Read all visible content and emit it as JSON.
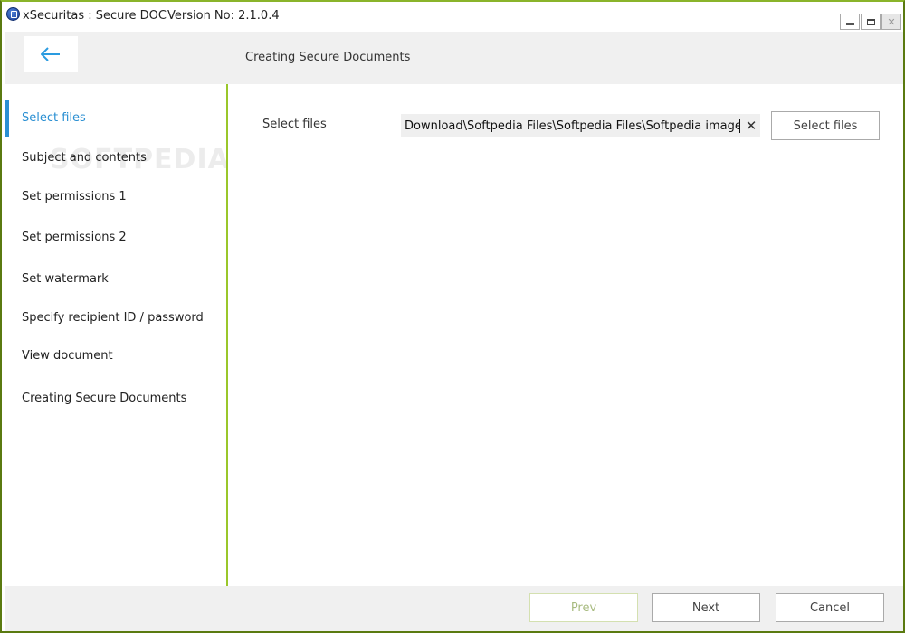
{
  "window": {
    "title": "xSecuritas : Secure DOC",
    "version": "Version No: 2.1.0.4",
    "controls": {
      "minimize_icon": "minimize-icon",
      "maximize_icon": "maximize-icon",
      "close_icon": "close-icon",
      "close_glyph": "✕"
    }
  },
  "header": {
    "back_icon": "arrow-left-icon",
    "title": "Creating Secure Documents"
  },
  "sidebar": {
    "active_index": 0,
    "watermark": "SOFTPEDIA",
    "items": [
      {
        "label": "Select files"
      },
      {
        "label": "Subject and contents"
      },
      {
        "label": "Set permissions 1"
      },
      {
        "label": "Set permissions 2"
      },
      {
        "label": "Set watermark"
      },
      {
        "label": "Specify recipient ID / password"
      },
      {
        "label": "View document"
      },
      {
        "label": "Creating Secure Documents"
      }
    ]
  },
  "main": {
    "field_label": "Select files",
    "path_value": "Download\\Softpedia Files\\Softpedia Files\\Softpedia images.PDF",
    "clear_glyph": "✕",
    "select_button_label": "Select files"
  },
  "footer": {
    "prev_label": "Prev",
    "prev_enabled": false,
    "next_label": "Next",
    "cancel_label": "Cancel"
  },
  "colors": {
    "accent": "#2a8fd2",
    "divider": "#9ac72a",
    "frame": "#5a7a10"
  }
}
